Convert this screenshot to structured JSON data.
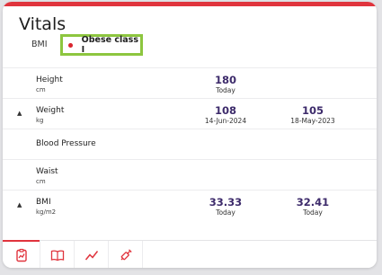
{
  "title": "Vitals",
  "bmi": {
    "label": "BMI",
    "status": "Obese class I"
  },
  "rows": [
    {
      "name": "Height",
      "unit": "cm",
      "values": [
        {
          "value": "180",
          "date": "Today"
        }
      ]
    },
    {
      "name": "Weight",
      "unit": "kg",
      "values": [
        {
          "value": "108",
          "date": "14-Jun-2024"
        },
        {
          "value": "105",
          "date": "18-May-2023"
        }
      ]
    },
    {
      "name": "Blood Pressure",
      "unit": "",
      "values": []
    },
    {
      "name": "Waist",
      "unit": "cm",
      "values": []
    },
    {
      "name": "BMI",
      "unit": "kg/m2",
      "values": [
        {
          "value": "33.33",
          "date": "Today"
        },
        {
          "value": "32.41",
          "date": "Today"
        }
      ]
    }
  ],
  "tabs": [
    {
      "icon": "clipboard-chart-icon",
      "active": true
    },
    {
      "icon": "book-icon",
      "active": false
    },
    {
      "icon": "trend-line-icon",
      "active": false
    },
    {
      "icon": "syringe-icon",
      "active": false
    }
  ],
  "colors": {
    "accent": "#e0343d",
    "value": "#3d2b6b",
    "highlight": "#8dc63f"
  }
}
